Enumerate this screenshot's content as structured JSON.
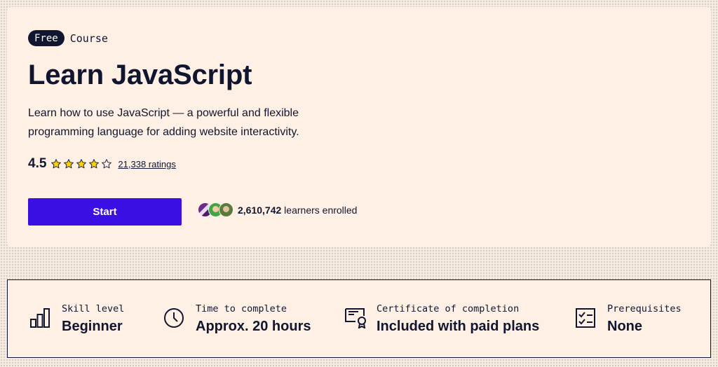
{
  "hero": {
    "badge": "Free",
    "type_label": "Course",
    "title": "Learn JavaScript",
    "description": "Learn how to use JavaScript — a powerful and flexible programming language for adding website interactivity.",
    "rating": "4.5",
    "stars_filled_fraction": 0.9,
    "ratings_link": "21,338 ratings",
    "start_button": "Start",
    "learners_count": "2,610,742",
    "learners_suffix": " learners enrolled"
  },
  "stats": [
    {
      "icon": "bar-chart-icon",
      "label": "Skill level",
      "value": "Beginner"
    },
    {
      "icon": "clock-icon",
      "label": "Time to complete",
      "value": "Approx. 20 hours"
    },
    {
      "icon": "certificate-icon",
      "label": "Certificate of completion",
      "value": "Included with paid plans"
    },
    {
      "icon": "checklist-icon",
      "label": "Prerequisites",
      "value": "None"
    }
  ],
  "colors": {
    "background": "#fff0e5",
    "ink": "#10162f",
    "accent": "#3a10e5",
    "star": "#ffd300"
  }
}
